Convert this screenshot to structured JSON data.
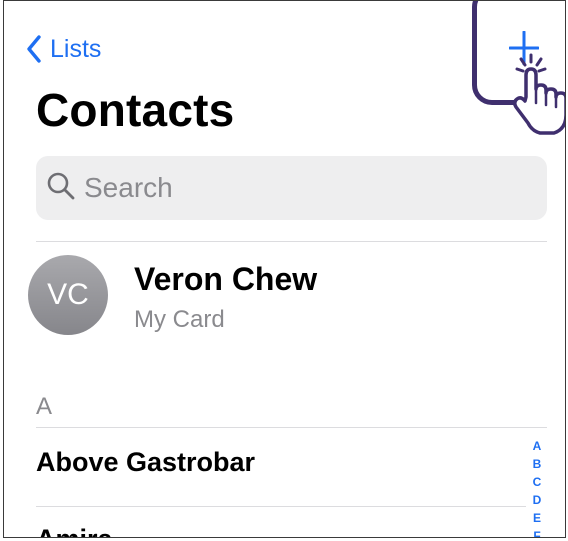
{
  "nav": {
    "back_label": "Lists",
    "add_icon": "plus-icon"
  },
  "title": "Contacts",
  "search": {
    "placeholder": "Search"
  },
  "my_card": {
    "initials": "VC",
    "name": "Veron Chew",
    "subtitle": "My Card"
  },
  "sections": [
    {
      "header": "A",
      "contacts": [
        "Above Gastrobar",
        "Amira"
      ]
    }
  ],
  "index_letters": [
    "A",
    "B",
    "C",
    "D",
    "E",
    "F"
  ],
  "colors": {
    "accent": "#1e6ff2",
    "highlight": "#3f2f6e",
    "search_bg": "#eeeeef",
    "secondary_text": "#8a8a8e"
  }
}
